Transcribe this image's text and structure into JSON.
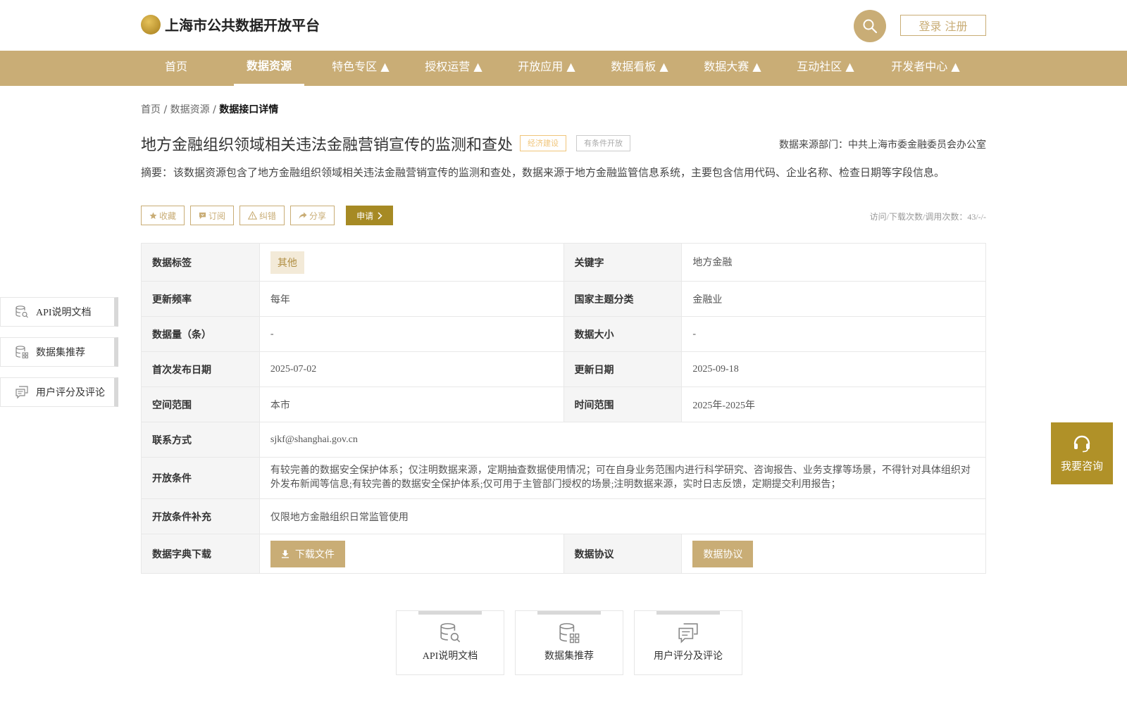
{
  "header": {
    "site_title": "上海市公共数据开放平台",
    "login_label": "登录 注册"
  },
  "nav": {
    "items": [
      {
        "label": "首页"
      },
      {
        "label": "数据资源"
      },
      {
        "label": "特色专区 ▲"
      },
      {
        "label": "授权运营 ▲"
      },
      {
        "label": "开放应用 ▲"
      },
      {
        "label": "数据看板 ▲"
      },
      {
        "label": "数据大赛 ▲"
      },
      {
        "label": "互动社区 ▲"
      },
      {
        "label": "开发者中心 ▲"
      }
    ],
    "active_index": 1
  },
  "breadcrumb": {
    "home": "首页",
    "sep1": " / ",
    "resources": "数据资源",
    "sep2": " / ",
    "current": "数据接口详情"
  },
  "detail": {
    "title": "地方金融组织领域相关违法金融营销宣传的监测和查处",
    "tag_topic": "经济建设",
    "tag_open": "有条件开放",
    "source": "数据来源部门：中共上海市委金融委员会办公室",
    "summary_label": "摘要：",
    "summary_text": "该数据资源包含了地方金融组织领域相关违法金融营销宣传的监测和查处，数据来源于地方金融监管信息系统，主要包含信用代码、企业名称、检查日期等字段信息。"
  },
  "actions": {
    "collect": "收藏",
    "subscribe": "订阅",
    "correct": "纠错",
    "share": "分享",
    "apply": "申请",
    "visits": "访问/下载次数/调用次数：43/-/-"
  },
  "info": {
    "data_tag_label": "数据标签",
    "data_tag_value": "其他",
    "keyword_label": "关键字",
    "keyword_value": "地方金融",
    "freq_label": "更新频率",
    "freq_value": "每年",
    "national_label": "国家主题分类",
    "national_value": "金融业",
    "count_label": "数据量（条）",
    "count_value": "-",
    "size_label": "数据大小",
    "size_value": "-",
    "first_pub_label": "首次发布日期",
    "first_pub_value": "2025-07-02",
    "update_label": "更新日期",
    "update_value": "2025-09-18",
    "space_label": "空间范围",
    "space_value": "本市",
    "time_label": "时间范围",
    "time_value": "2025年-2025年",
    "contact_label": "联系方式",
    "contact_value": "sjkf@shanghai.gov.cn",
    "cond_label": "开放条件",
    "cond_value": "有较完善的数据安全保护体系；仅注明数据来源，定期抽查数据使用情况；可在自身业务范围内进行科学研究、咨询报告、业务支撑等场景，不得针对具体组织对外发布新闻等信息;有较完善的数据安全保护体系;仅可用于主管部门授权的场景;注明数据来源，实时日志反馈，定期提交利用报告；",
    "cond_sup_label": "开放条件补充",
    "cond_sup_value": "仅限地方金融组织日常监管使用",
    "dict_label": "数据字典下载",
    "dict_button": "下载文件",
    "protocol_label": "数据协议",
    "protocol_button": "数据协议"
  },
  "side_nav": {
    "api_doc": "API说明文档",
    "recommend": "数据集推荐",
    "rating": "用户评分及评论"
  },
  "consult": {
    "label": "我要咨询"
  },
  "cards": {
    "api_doc": "API说明文档",
    "recommend": "数据集推荐",
    "rating": "用户评分及评论"
  },
  "colors": {
    "brand": "#c9ad76",
    "apply": "#a68a24",
    "consult": "#b09128"
  }
}
